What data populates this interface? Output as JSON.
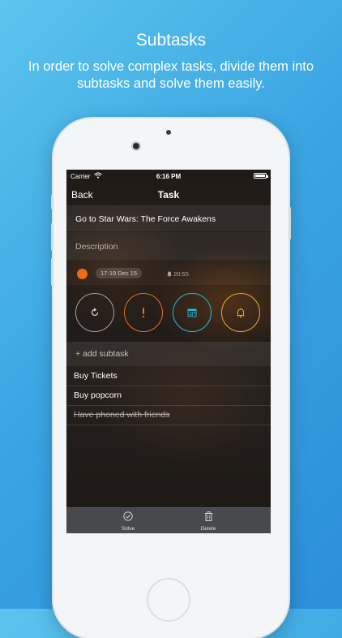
{
  "promo": {
    "title": "Subtasks",
    "subtitle": "In order to solve complex tasks, divide them into subtasks and solve them easily."
  },
  "status_bar": {
    "carrier": "Carrier",
    "time": "6:16 PM"
  },
  "nav": {
    "back_label": "Back",
    "title": "Task"
  },
  "task": {
    "title": "Go to Star Wars: The Force Awakens",
    "description_placeholder": "Description",
    "date_range": "17-19 Dec 15",
    "time": "20:55",
    "priority_color": "#ef6a1a"
  },
  "actions": [
    {
      "icon": "repeat-icon",
      "color": "#a7a3a0"
    },
    {
      "icon": "priority-icon",
      "color": "#ef6a1a"
    },
    {
      "icon": "calendar-icon",
      "color": "#2cb8d8"
    },
    {
      "icon": "bell-icon",
      "color": "#f0a92a"
    }
  ],
  "subtasks": {
    "add_label": "+ add subtask",
    "items": [
      {
        "label": "Buy Tickets",
        "done": false
      },
      {
        "label": "Buy popcorn",
        "done": false
      },
      {
        "label": "Have phoned with friends",
        "done": true
      }
    ]
  },
  "toolbar": {
    "solve_label": "Solve",
    "delete_label": "Delete"
  }
}
